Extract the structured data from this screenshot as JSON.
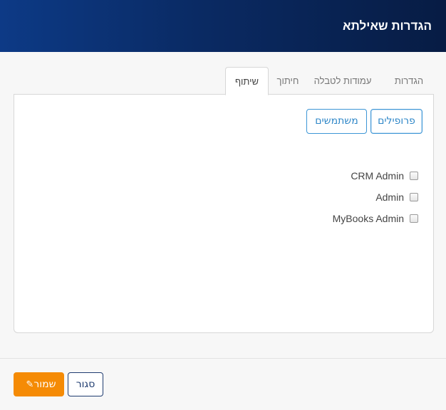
{
  "header": {
    "title": "הגדרות שאילתא"
  },
  "tabs": [
    {
      "label": "הגדרות"
    },
    {
      "label": "עמודות לטבלה"
    },
    {
      "label": "חיתוך"
    },
    {
      "label": "שיתוף"
    }
  ],
  "active_tab": "שיתוף",
  "share": {
    "buttons": {
      "profiles": "פרופילים",
      "users": "משתמשים"
    },
    "options": [
      {
        "label": "CRM Admin",
        "checked": false
      },
      {
        "label": "Admin",
        "checked": false
      },
      {
        "label": "MyBooks Admin",
        "checked": false
      }
    ]
  },
  "footer": {
    "save_label": "שמור",
    "close_label": "סגור",
    "save_icon": "pencil-icon"
  },
  "colors": {
    "header_bg": "#0a2a63",
    "accent": "#3d96d6",
    "save": "#f58b05"
  }
}
